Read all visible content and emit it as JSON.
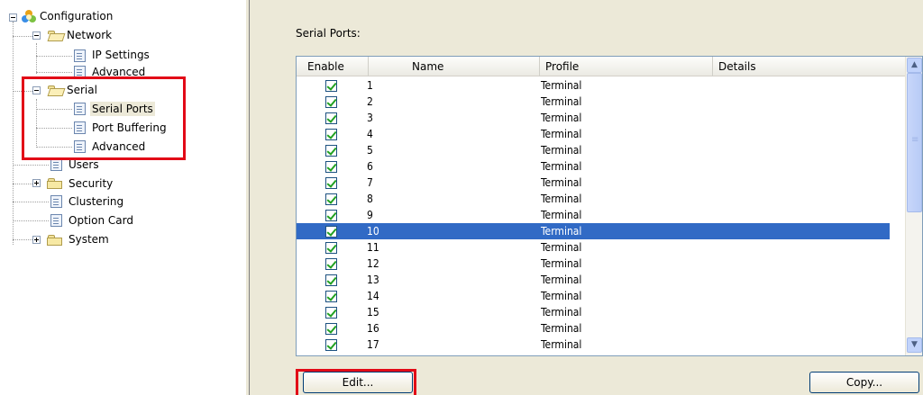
{
  "tree": {
    "root": "Configuration",
    "network": "Network",
    "ip_settings": "IP Settings",
    "network_advanced": "Advanced",
    "serial": "Serial",
    "serial_ports": "Serial Ports",
    "port_buffering": "Port Buffering",
    "serial_advanced": "Advanced",
    "users": "Users",
    "security": "Security",
    "clustering": "Clustering",
    "option_card": "Option Card",
    "system": "System"
  },
  "panel": {
    "title": "Serial Ports:",
    "columns": [
      "Enable",
      "Name",
      "Profile",
      "Details"
    ],
    "selected_row": "10",
    "rows": [
      {
        "enabled": true,
        "num": "1",
        "profile": "Terminal"
      },
      {
        "enabled": true,
        "num": "2",
        "profile": "Terminal"
      },
      {
        "enabled": true,
        "num": "3",
        "profile": "Terminal"
      },
      {
        "enabled": true,
        "num": "4",
        "profile": "Terminal"
      },
      {
        "enabled": true,
        "num": "5",
        "profile": "Terminal"
      },
      {
        "enabled": true,
        "num": "6",
        "profile": "Terminal"
      },
      {
        "enabled": true,
        "num": "7",
        "profile": "Terminal"
      },
      {
        "enabled": true,
        "num": "8",
        "profile": "Terminal"
      },
      {
        "enabled": true,
        "num": "9",
        "profile": "Terminal"
      },
      {
        "enabled": true,
        "num": "10",
        "profile": "Terminal"
      },
      {
        "enabled": true,
        "num": "11",
        "profile": "Terminal"
      },
      {
        "enabled": true,
        "num": "12",
        "profile": "Terminal"
      },
      {
        "enabled": true,
        "num": "13",
        "profile": "Terminal"
      },
      {
        "enabled": true,
        "num": "14",
        "profile": "Terminal"
      },
      {
        "enabled": true,
        "num": "15",
        "profile": "Terminal"
      },
      {
        "enabled": true,
        "num": "16",
        "profile": "Terminal"
      },
      {
        "enabled": true,
        "num": "17",
        "profile": "Terminal"
      }
    ],
    "edit_label": "Edit...",
    "copy_label": "Copy..."
  },
  "colors": {
    "highlight_box": "#e20a17",
    "selection": "#316ac5"
  }
}
